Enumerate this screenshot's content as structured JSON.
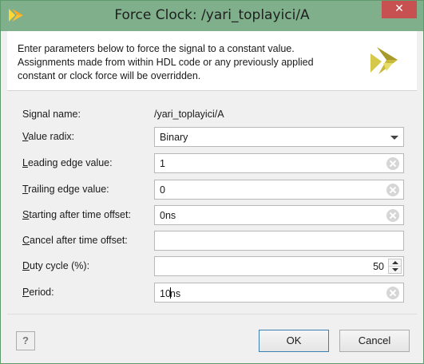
{
  "window": {
    "title": "Force Clock:  /yari_toplayici/A",
    "close_glyph": "✕",
    "accent_color": "#7fb08b"
  },
  "description": "Enter parameters below to force the signal to a constant value. Assignments made from within HDL code or any previously applied constant or clock force will be overridden.",
  "form": {
    "signal_name": {
      "label": "Signal name:",
      "value": "/yari_toplayici/A"
    },
    "value_radix": {
      "mnemonic": "V",
      "label_rest": "alue radix:",
      "value": "Binary"
    },
    "leading_edge": {
      "mnemonic": "L",
      "label_rest": "eading edge value:",
      "value": "1"
    },
    "trailing_edge": {
      "mnemonic": "T",
      "label_rest": "railing edge value:",
      "value": "0"
    },
    "start_offset": {
      "mnemonic": "S",
      "label_rest": "tarting after time offset:",
      "value": "0ns"
    },
    "cancel_offset": {
      "mnemonic": "C",
      "label_rest": "ancel after time offset:",
      "value": ""
    },
    "duty_cycle": {
      "mnemonic": "D",
      "label_rest": "uty cycle (%):",
      "value": "50"
    },
    "period": {
      "mnemonic": "P",
      "label_rest": "eriod:",
      "value_before_caret": "10",
      "value_after_caret": "ns"
    }
  },
  "buttons": {
    "help": "?",
    "ok": "OK",
    "cancel": "Cancel"
  },
  "icons": {
    "app_logo": "vivado-logo-icon",
    "clear": "clear-circle-icon",
    "dropdown": "chevron-down-icon",
    "spinner": "spinner-arrows-icon"
  }
}
